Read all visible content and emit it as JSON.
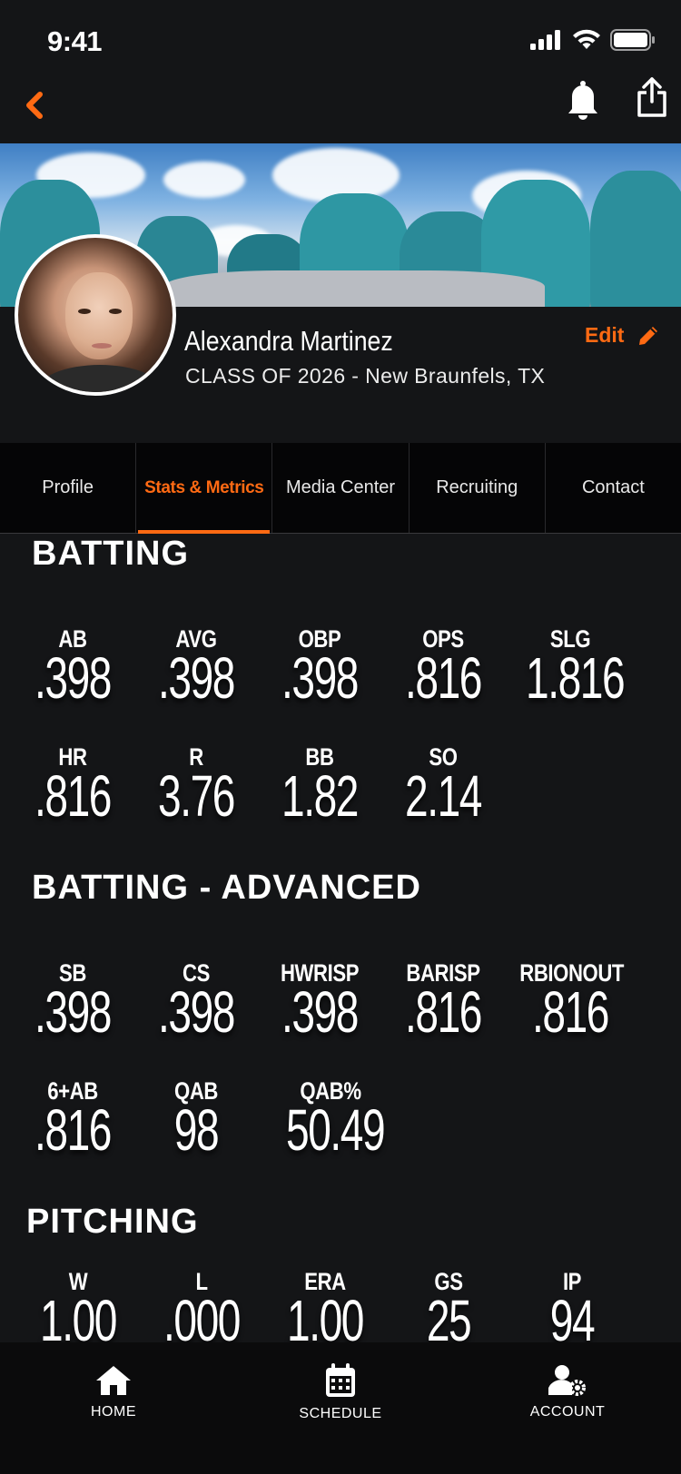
{
  "status": {
    "time": "9:41"
  },
  "profile": {
    "name": "Alexandra Martinez",
    "meta": "CLASS OF 2026 - New Braunfels, TX",
    "edit_label": "Edit"
  },
  "tabs": [
    {
      "label": "Profile",
      "active": false
    },
    {
      "label": "Stats & Metrics",
      "active": true
    },
    {
      "label": "Media Center",
      "active": false
    },
    {
      "label": "Recruiting",
      "active": false
    },
    {
      "label": "Contact",
      "active": false
    }
  ],
  "sections": {
    "batting": {
      "title": "BATTING",
      "stats": [
        {
          "label": "AB",
          "value": ".398"
        },
        {
          "label": "AVG",
          "value": ".398"
        },
        {
          "label": "OBP",
          "value": ".398"
        },
        {
          "label": "OPS",
          "value": ".816"
        },
        {
          "label": "SLG",
          "value": "1.816"
        },
        {
          "label": "HR",
          "value": ".816"
        },
        {
          "label": "R",
          "value": "3.76"
        },
        {
          "label": "BB",
          "value": "1.82"
        },
        {
          "label": "SO",
          "value": "2.14"
        }
      ]
    },
    "batting_advanced": {
      "title": "BATTING - ADVANCED",
      "stats": [
        {
          "label": "SB",
          "value": ".398"
        },
        {
          "label": "CS",
          "value": ".398"
        },
        {
          "label": "HWRISP",
          "value": ".398"
        },
        {
          "label": "BARISP",
          "value": ".816"
        },
        {
          "label": "RBIONOUT",
          "value": ".816"
        },
        {
          "label": "6+AB",
          "value": ".816"
        },
        {
          "label": "QAB",
          "value": "98"
        },
        {
          "label": "QAB%",
          "value": "50.49"
        }
      ]
    },
    "pitching": {
      "title": "PITCHING",
      "stats": [
        {
          "label": "W",
          "value": "1.00"
        },
        {
          "label": "L",
          "value": ".000"
        },
        {
          "label": "ERA",
          "value": "1.00"
        },
        {
          "label": "GS",
          "value": "25"
        },
        {
          "label": "IP",
          "value": "94"
        }
      ]
    }
  },
  "bottom_nav": [
    {
      "label": "HOME",
      "icon": "home-icon"
    },
    {
      "label": "SCHEDULE",
      "icon": "calendar-icon"
    },
    {
      "label": "ACCOUNT",
      "icon": "account-settings-icon"
    }
  ],
  "colors": {
    "accent": "#ff6a13",
    "background": "#141517",
    "tab_bar": "#050506",
    "nav": "#0b0b0c"
  }
}
